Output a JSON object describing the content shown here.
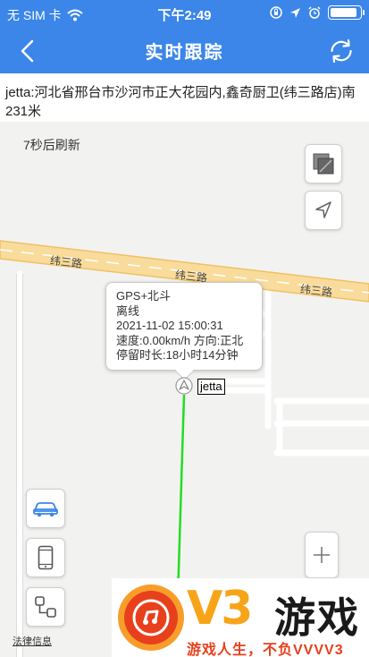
{
  "status_bar": {
    "carrier": "无 SIM 卡",
    "time": "下午2:49"
  },
  "nav": {
    "title": "实时跟踪"
  },
  "address": {
    "text": "jetta:河北省邢台市沙河市正大花园内,鑫奇厨卫(纬三路店)南231米"
  },
  "map": {
    "refresh_countdown": "7秒后刷新",
    "road_name": "纬三路",
    "info": {
      "signal_type": "GPS+北斗",
      "online_status": "离线",
      "datetime": "2021-11-02 15:00:31",
      "speed_direction": "速度:0.00km/h 方向:正北",
      "stop_duration": "停留时长:18小时14分钟"
    },
    "vehicle_label": "jetta",
    "legal_link": "法律信息",
    "track_color": "#22dd22"
  },
  "watermark": {
    "logo_text": "V3",
    "brand": "游戏",
    "slogan": "游戏人生，不负VVVV3"
  },
  "colors": {
    "accent": "#3b86e8",
    "road_fill": "#f9dc9c",
    "road_stroke": "#f0c063"
  }
}
